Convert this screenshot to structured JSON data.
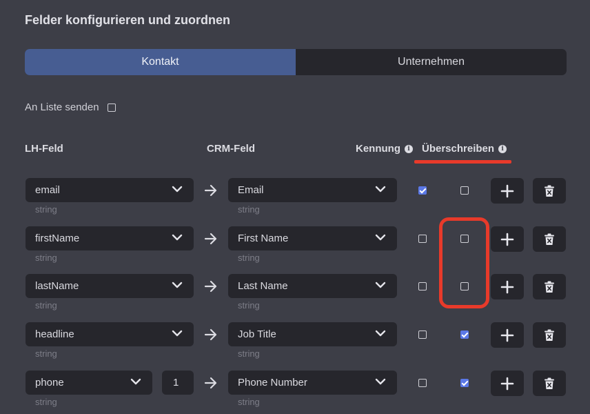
{
  "title": "Felder konfigurieren und zuordnen",
  "tabs": [
    {
      "label": "Kontakt",
      "active": true
    },
    {
      "label": "Unternehmen",
      "active": false
    }
  ],
  "send_to_list": {
    "label": "An Liste senden",
    "checked": false
  },
  "headers": {
    "lh_field": "LH-Feld",
    "crm_field": "CRM-Feld",
    "identifier": "Kennung",
    "overwrite": "Überschreiben",
    "info_icon": "info-icon"
  },
  "colors": {
    "accent": "#475d92",
    "checkbox": "#5b78e6",
    "highlight": "#e83a2a"
  },
  "rows": [
    {
      "lh": "email",
      "lh_type": "string",
      "crm": "Email",
      "crm_type": "string",
      "identifier": true,
      "overwrite": false
    },
    {
      "lh": "firstName",
      "lh_type": "string",
      "crm": "First Name",
      "crm_type": "string",
      "identifier": false,
      "overwrite": false
    },
    {
      "lh": "lastName",
      "lh_type": "string",
      "crm": "Last Name",
      "crm_type": "string",
      "identifier": false,
      "overwrite": false
    },
    {
      "lh": "headline",
      "lh_type": "string",
      "crm": "Job Title",
      "crm_type": "string",
      "identifier": false,
      "overwrite": true
    },
    {
      "lh": "phone",
      "lh_type": "string",
      "index": "1",
      "crm": "Phone Number",
      "crm_type": "string",
      "identifier": false,
      "overwrite": true
    }
  ]
}
